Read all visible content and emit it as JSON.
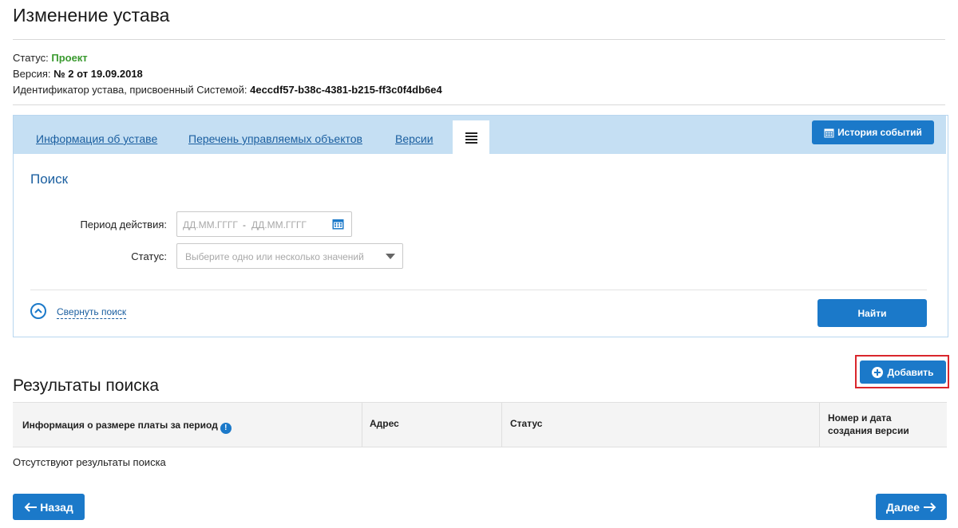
{
  "page": {
    "title": "Изменение устава"
  },
  "meta": {
    "status_label": "Статус:",
    "status_value": "Проект",
    "version_label": "Версия:",
    "version_value": "№ 2 от 19.09.2018",
    "id_label": "Идентификатор устава, присвоенный Системой:",
    "id_value": "4eccdf57-b38c-4381-b215-ff3c0f4db6e4"
  },
  "tabs": {
    "items": [
      {
        "label": "Информация об уставе"
      },
      {
        "label": "Перечень управляемых объектов"
      },
      {
        "label": "Версии"
      }
    ],
    "history_button": "История событий"
  },
  "search": {
    "title": "Поиск",
    "period_label": "Период действия:",
    "date_from_placeholder": "ДД.ММ.ГГГГ",
    "date_separator": "-",
    "date_to_placeholder": "ДД.ММ.ГГГГ",
    "status_label": "Статус:",
    "status_placeholder": "Выберите одно или несколько значений",
    "collapse_link": "Свернуть поиск",
    "find_button": "Найти"
  },
  "results": {
    "title": "Результаты поиска",
    "add_button": "Добавить",
    "columns": [
      "Информация о размере платы за период",
      "Адрес",
      "Статус",
      "Номер и дата создания версии"
    ],
    "empty_message": "Отсутствуют результаты поиска"
  },
  "footer": {
    "back_button": "Назад",
    "next_button": "Далее"
  },
  "colors": {
    "accent": "#1b79c9",
    "status_green": "#3a9a2f",
    "highlight_red": "#d9262c",
    "tabbar_bg": "#c5dff3"
  }
}
